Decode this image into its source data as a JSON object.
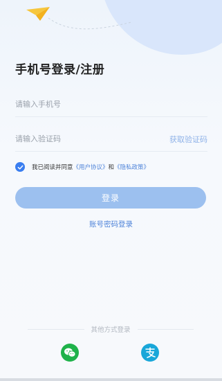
{
  "header": {
    "title": "手机号登录/注册"
  },
  "form": {
    "phone_placeholder": "请输入手机号",
    "code_placeholder": "请输入验证码",
    "get_code_label": "获取验证码"
  },
  "agreement": {
    "checked": true,
    "prefix": "我已阅读并同意",
    "user_agreement": "《用户协议》",
    "conjunction": "和",
    "privacy_policy": "《隐私政策》"
  },
  "buttons": {
    "login_label": "登录",
    "account_login_label": "账号密码登录"
  },
  "other_login": {
    "label": "其他方式登录",
    "methods": [
      {
        "name": "wechat",
        "icon": "wechat-icon",
        "color": "#1fb24a"
      },
      {
        "name": "alipay",
        "icon": "alipay-icon",
        "color": "#19a7d9"
      }
    ]
  },
  "colors": {
    "accent": "#3a7ef0",
    "button": "#9cc0ef",
    "link": "#4f84d9"
  }
}
